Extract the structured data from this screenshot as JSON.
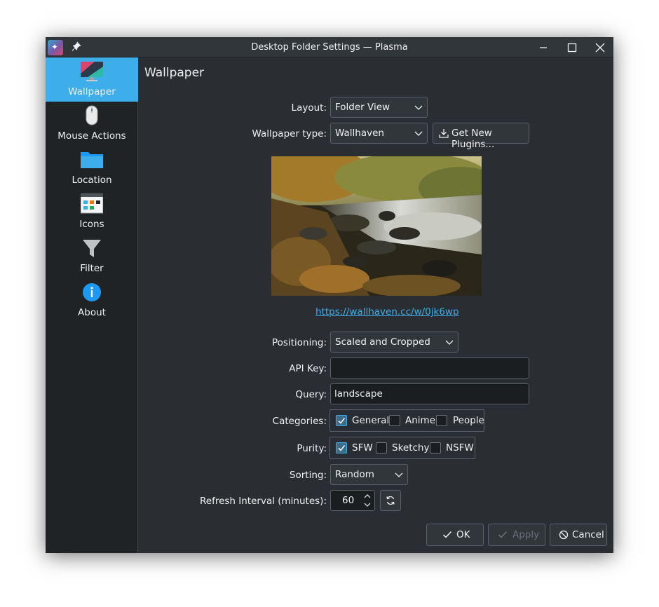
{
  "window": {
    "title": "Desktop Folder Settings — Plasma"
  },
  "sidebar": {
    "items": [
      {
        "label": "Wallpaper",
        "icon": "monitor-wallpaper-icon",
        "active": true
      },
      {
        "label": "Mouse Actions",
        "icon": "mouse-icon",
        "active": false
      },
      {
        "label": "Location",
        "icon": "folder-icon",
        "active": false
      },
      {
        "label": "Icons",
        "icon": "icons-grid-icon",
        "active": false
      },
      {
        "label": "Filter",
        "icon": "funnel-icon",
        "active": false
      },
      {
        "label": "About",
        "icon": "info-icon",
        "active": false
      }
    ]
  },
  "page": {
    "title": "Wallpaper"
  },
  "form": {
    "layout_label": "Layout:",
    "layout_value": "Folder View",
    "wallpaper_type_label": "Wallpaper type:",
    "wallpaper_type_value": "Wallhaven",
    "get_plugins_label": "Get New Plugins...",
    "link": "https://wallhaven.cc/w/0jk6wp",
    "positioning_label": "Positioning:",
    "positioning_value": "Scaled and Cropped",
    "api_key_label": "API Key:",
    "api_key_value": "",
    "query_label": "Query:",
    "query_value": "landscape",
    "categories_label": "Categories:",
    "categories": [
      {
        "label": "General",
        "checked": true
      },
      {
        "label": "Anime",
        "checked": false
      },
      {
        "label": "People",
        "checked": false
      }
    ],
    "purity_label": "Purity:",
    "purity": [
      {
        "label": "SFW",
        "checked": true
      },
      {
        "label": "Sketchy",
        "checked": false
      },
      {
        "label": "NSFW",
        "checked": false
      }
    ],
    "sorting_label": "Sorting:",
    "sorting_value": "Random",
    "refresh_label": "Refresh Interval (minutes):",
    "refresh_value": "60"
  },
  "buttons": {
    "ok": "OK",
    "apply": "Apply",
    "cancel": "Cancel"
  },
  "colors": {
    "accent": "#3daee9",
    "window_bg": "#2a2e32",
    "sidebar_bg": "#202326"
  }
}
